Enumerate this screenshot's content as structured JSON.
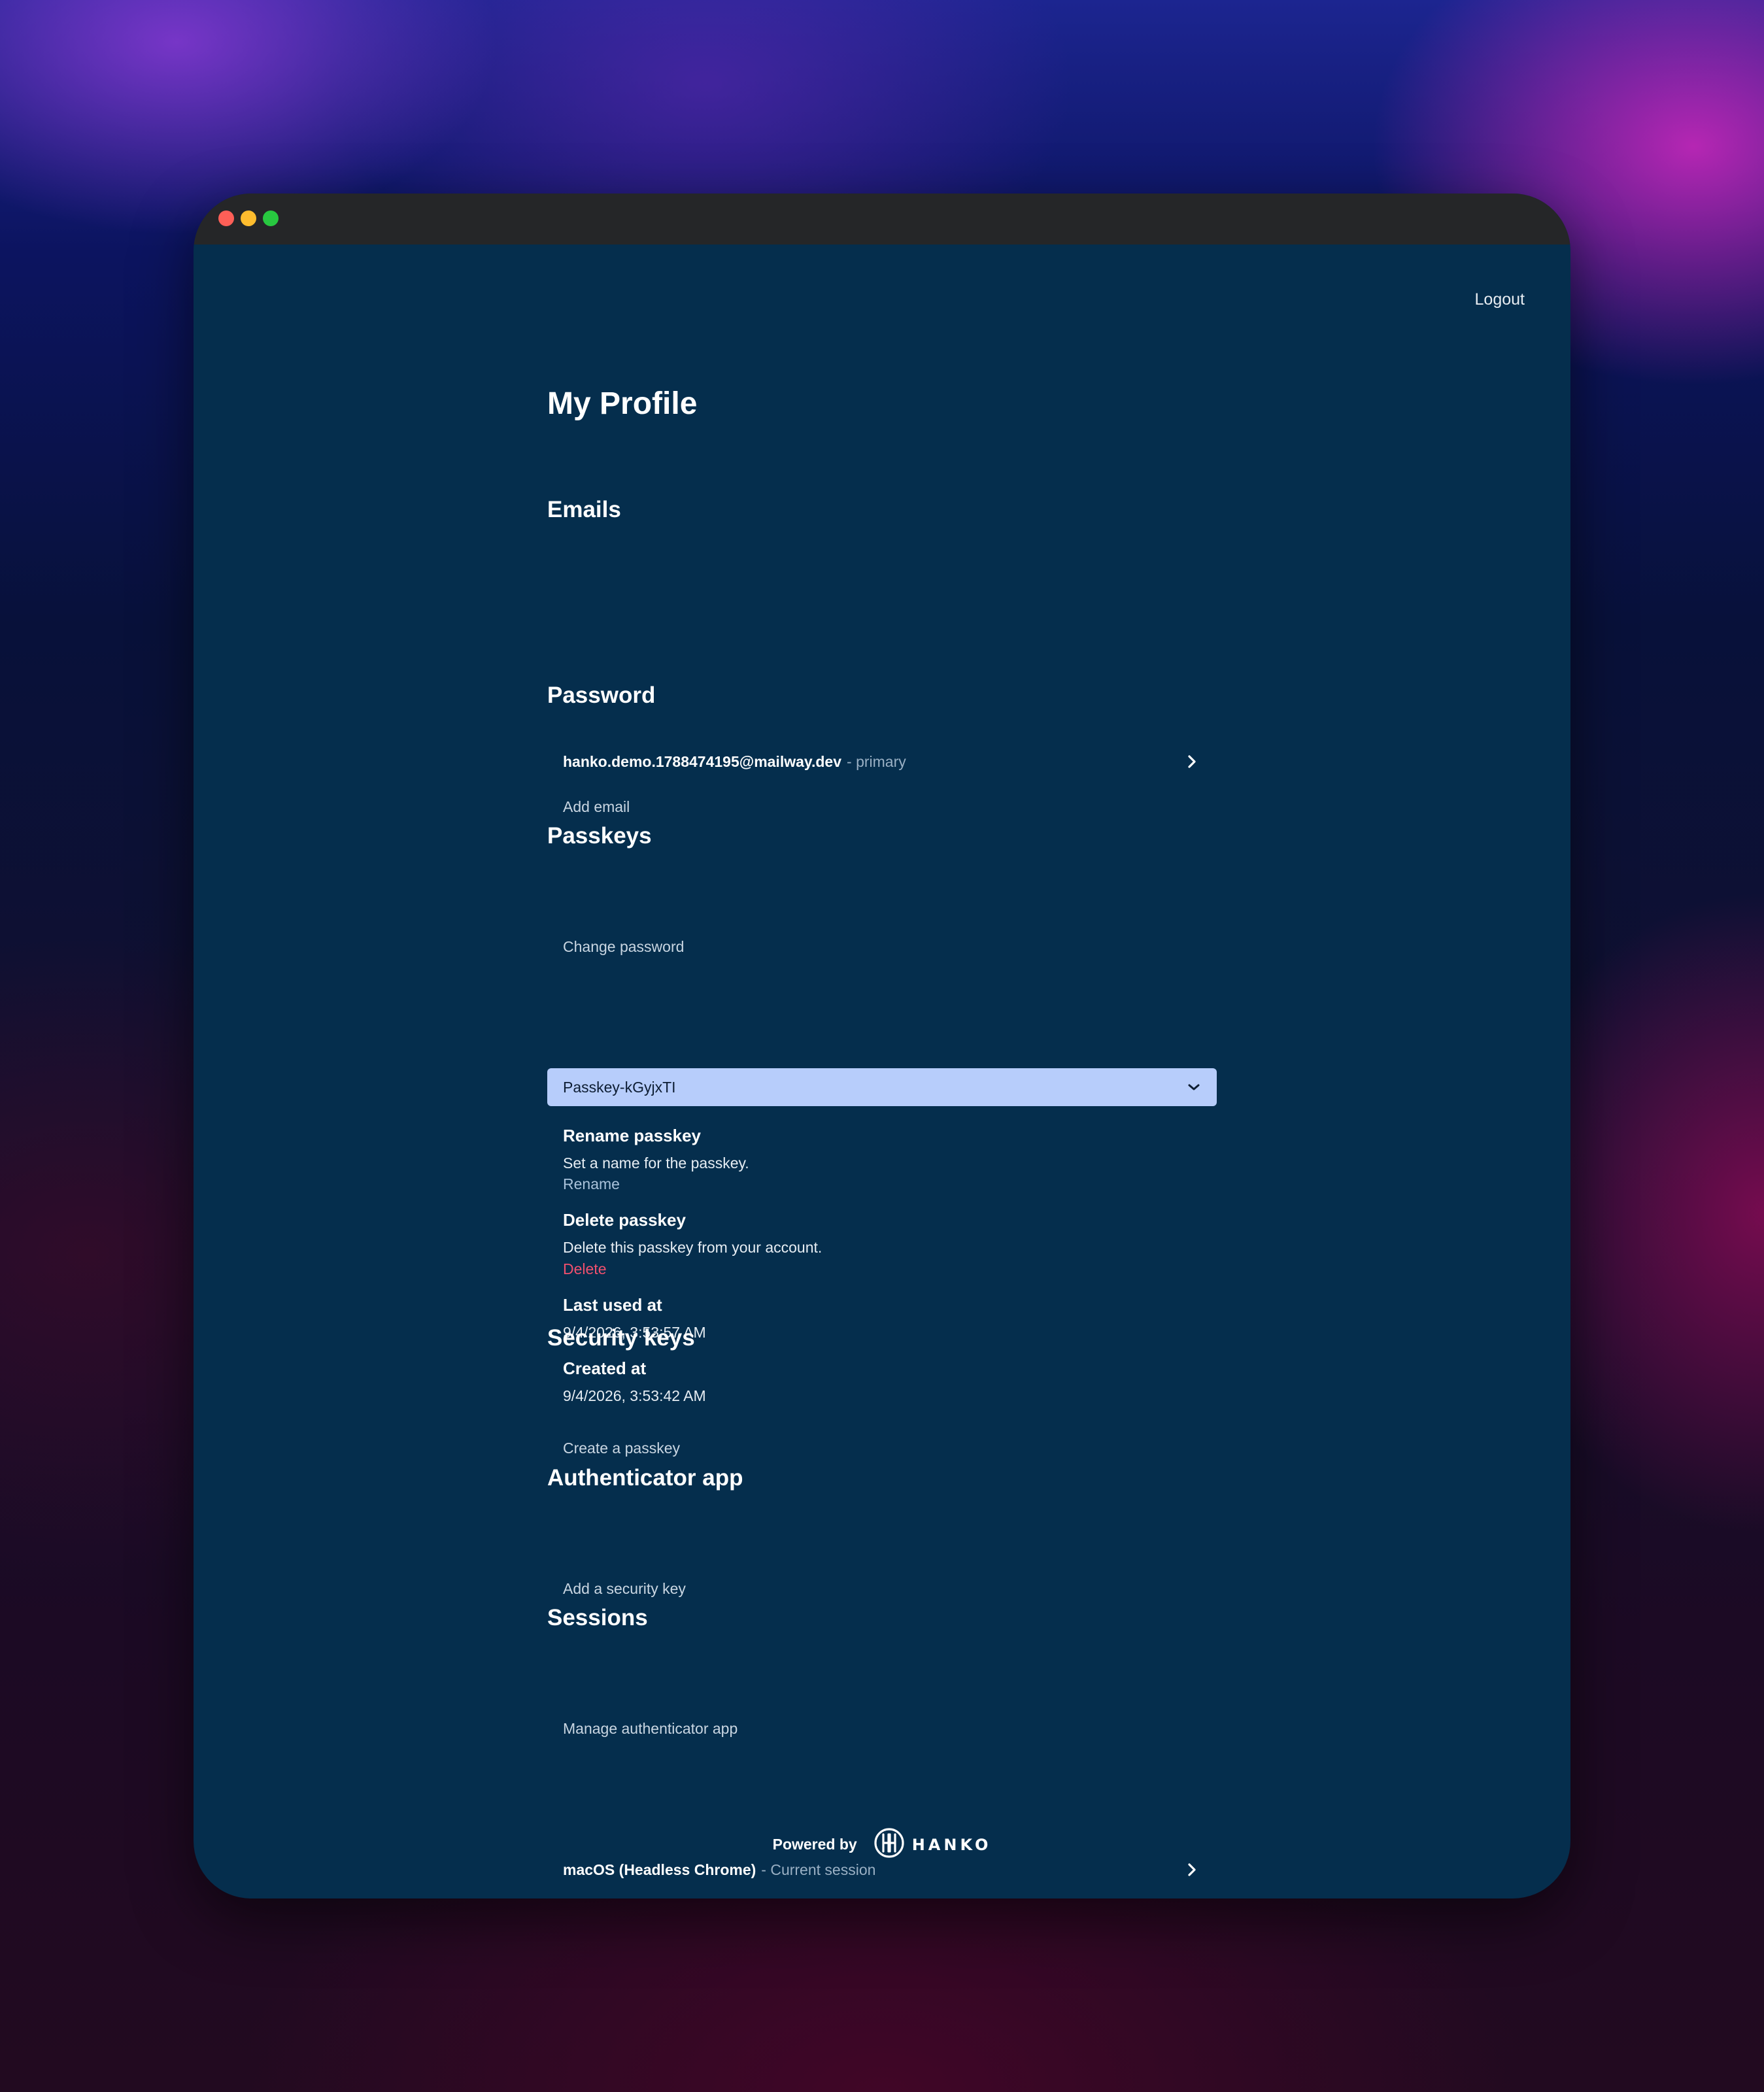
{
  "header": {
    "logout_label": "Logout"
  },
  "profile": {
    "title": "My Profile"
  },
  "emails": {
    "title": "Emails",
    "items": [
      {
        "address": "hanko.demo.1788474195@mailway.dev",
        "tag": "- primary"
      }
    ],
    "add_label": "Add email"
  },
  "password": {
    "title": "Password",
    "change_label": "Change password"
  },
  "passkeys": {
    "title": "Passkeys",
    "selected": "Passkey-kGyjxTI",
    "rename": {
      "title": "Rename passkey",
      "description": "Set a name for the passkey.",
      "action": "Rename"
    },
    "delete": {
      "title": "Delete passkey",
      "description": "Delete this passkey from your account.",
      "action": "Delete"
    },
    "last_used": {
      "title": "Last used at",
      "value": "9/4/2026, 3:53:57 AM"
    },
    "created": {
      "title": "Created at",
      "value": "9/4/2026, 3:53:42 AM"
    },
    "create_label": "Create a passkey"
  },
  "security_keys": {
    "title": "Security keys",
    "add_label": "Add a security key"
  },
  "authenticator": {
    "title": "Authenticator app",
    "manage_label": "Manage authenticator app"
  },
  "sessions": {
    "title": "Sessions",
    "items": [
      {
        "device": "macOS (Headless Chrome)",
        "tag": "- Current session"
      }
    ]
  },
  "footer": {
    "powered_by": "Powered by",
    "brand": "HANKO"
  },
  "colors": {
    "window_bg": "#052e4d",
    "titlebar": "#252628",
    "dropdown_bg": "#b7cdfb",
    "danger": "#f0506e"
  }
}
